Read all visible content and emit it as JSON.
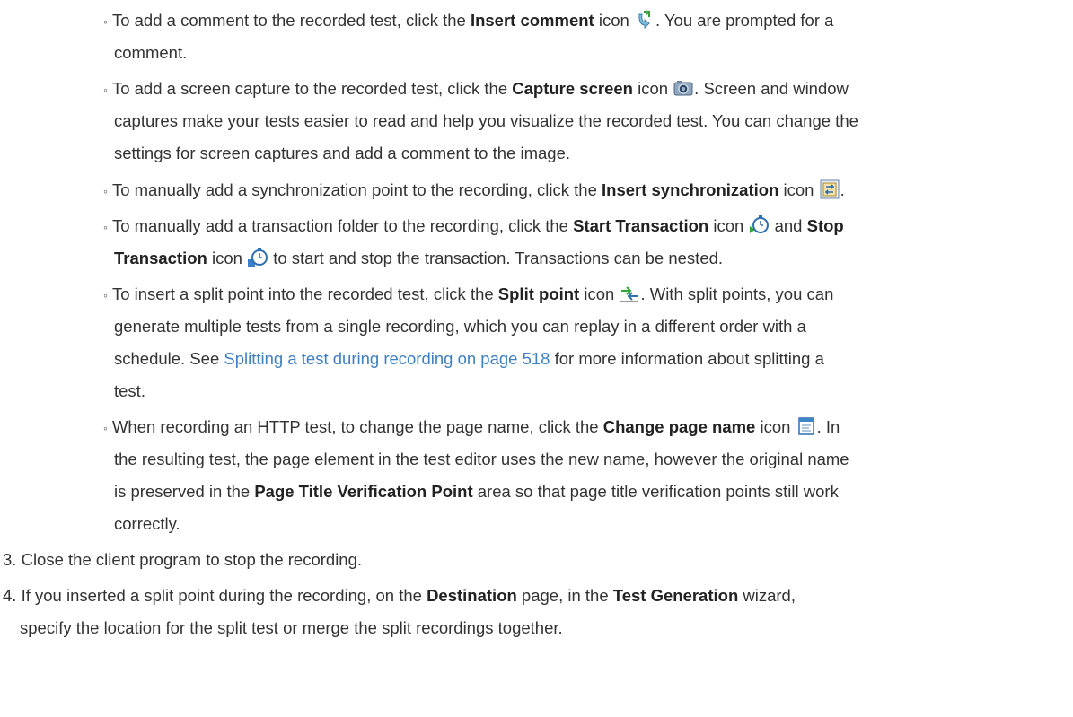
{
  "items": {
    "comment": {
      "t1": "To add a comment to the recorded test, click the ",
      "b1": "Insert comment",
      "t2": " icon ",
      "t3": ". You are prompted for a",
      "l2": "comment.",
      "icon": "insert-comment-icon"
    },
    "capture": {
      "t1": "To add a screen capture to the recorded test, click the ",
      "b1": "Capture screen",
      "t2": " icon ",
      "t3": ". Screen and window",
      "l2": "captures make your tests easier to read and help you visualize the recorded test. You can change the",
      "l3": "settings for screen captures and add a comment to the image.",
      "icon": "camera-icon"
    },
    "sync": {
      "t1": "To manually add a synchronization point to the recording, click the ",
      "b1": "Insert synchronization",
      "t2": " icon ",
      "t3": ".",
      "icon": "synchronization-icon"
    },
    "transaction": {
      "t1": "To manually add a transaction folder to the recording, click the ",
      "b1": "Start Transaction",
      "t2": " icon ",
      "t3": " and ",
      "b2": "Stop",
      "b3": "Transaction",
      "t4": " icon ",
      "t5": " to start and stop the transaction. Transactions can be nested.",
      "icon_start": "start-transaction-icon",
      "icon_stop": "stop-transaction-icon"
    },
    "split": {
      "t1": "To insert a split point into the recorded test, click the ",
      "b1": "Split point",
      "t2": " icon ",
      "t3": ". With split points, you can",
      "l2": "generate multiple tests from a single recording, which you can replay in a different order with a",
      "l3a": "schedule. See ",
      "link": "Splitting a test during recording on page 518",
      "l3b": " for more information about splitting a",
      "l4": "test.",
      "icon": "split-point-icon"
    },
    "pagename": {
      "t1": "When recording an HTTP test, to change the page name, click the ",
      "b1": "Change page name",
      "t2": " icon ",
      "t3": ". In",
      "l2": "the resulting test, the page element in the test editor uses the new name, however the original name",
      "l3a": "is preserved in the ",
      "b2": "Page Title Verification Point",
      "l3b": " area so that page title verification points still work",
      "l4": "correctly.",
      "icon": "change-page-name-icon"
    }
  },
  "steps": {
    "s3": {
      "num": "3.",
      "text": "Close the client program to stop the recording."
    },
    "s4": {
      "num": "4.",
      "t1": "If you inserted a split point during the recording, on the ",
      "b1": "Destination",
      "t2": " page, in the ",
      "b2": "Test Generation",
      "t3": " wizard,",
      "l2": "specify the location for the split test or merge the split recordings together."
    }
  },
  "bullet_char": "◦",
  "colors": {
    "text": "#333333",
    "link": "#3f7fc2"
  }
}
